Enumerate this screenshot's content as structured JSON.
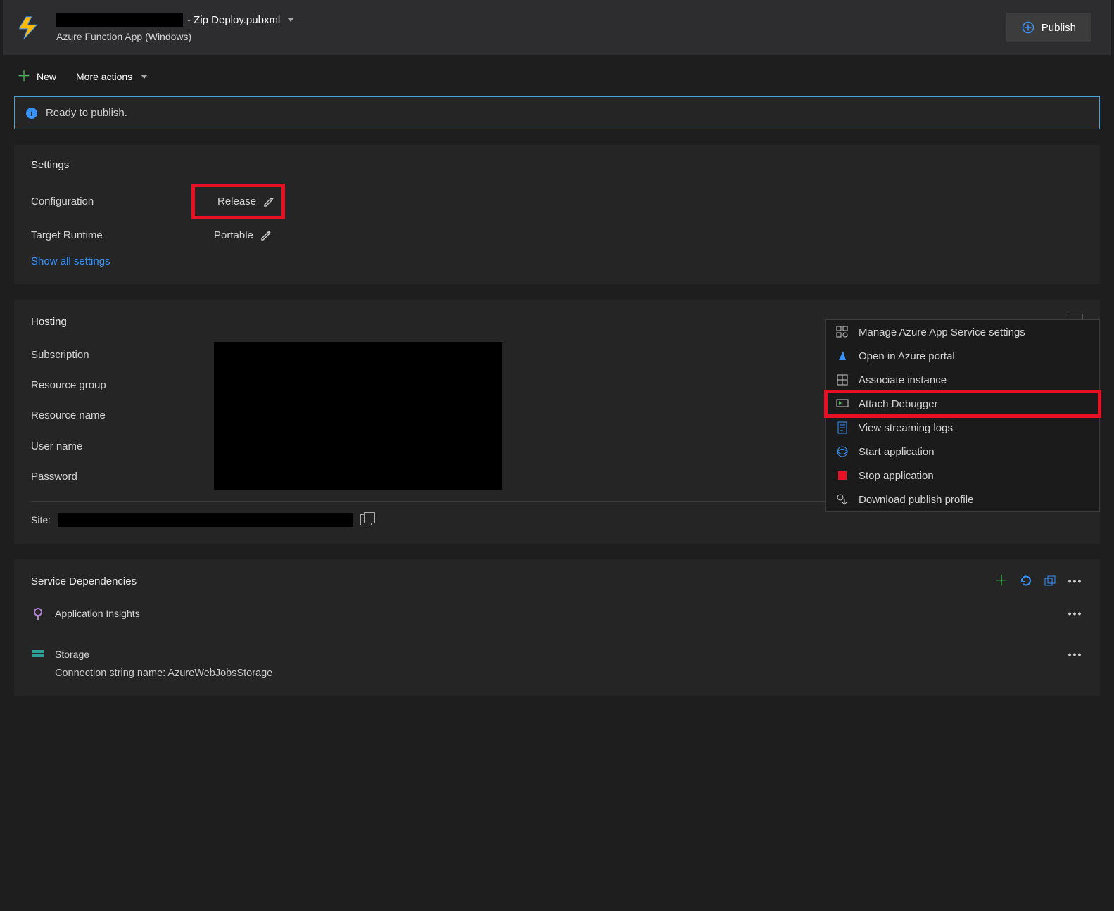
{
  "header": {
    "profile_suffix": "- Zip Deploy.pubxml",
    "subtitle": "Azure Function App (Windows)",
    "publish_label": "Publish"
  },
  "toolbar": {
    "new_label": "New",
    "more_actions_label": "More actions"
  },
  "status": {
    "text": "Ready to publish."
  },
  "settings": {
    "title": "Settings",
    "configuration_label": "Configuration",
    "configuration_value": "Release",
    "target_runtime_label": "Target Runtime",
    "target_runtime_value": "Portable",
    "show_all": "Show all settings"
  },
  "hosting": {
    "title": "Hosting",
    "subscription_label": "Subscription",
    "resource_group_label": "Resource group",
    "resource_name_label": "Resource name",
    "user_name_label": "User name",
    "password_label": "Password",
    "site_label": "Site:"
  },
  "context_menu": {
    "items": [
      "Manage Azure App Service settings",
      "Open in Azure portal",
      "Associate instance",
      "Attach Debugger",
      "View streaming logs",
      "Start application",
      "Stop application",
      "Download publish profile"
    ]
  },
  "dependencies": {
    "title": "Service Dependencies",
    "app_insights": "Application Insights",
    "storage": "Storage",
    "storage_sub": "Connection string name: AzureWebJobsStorage"
  }
}
